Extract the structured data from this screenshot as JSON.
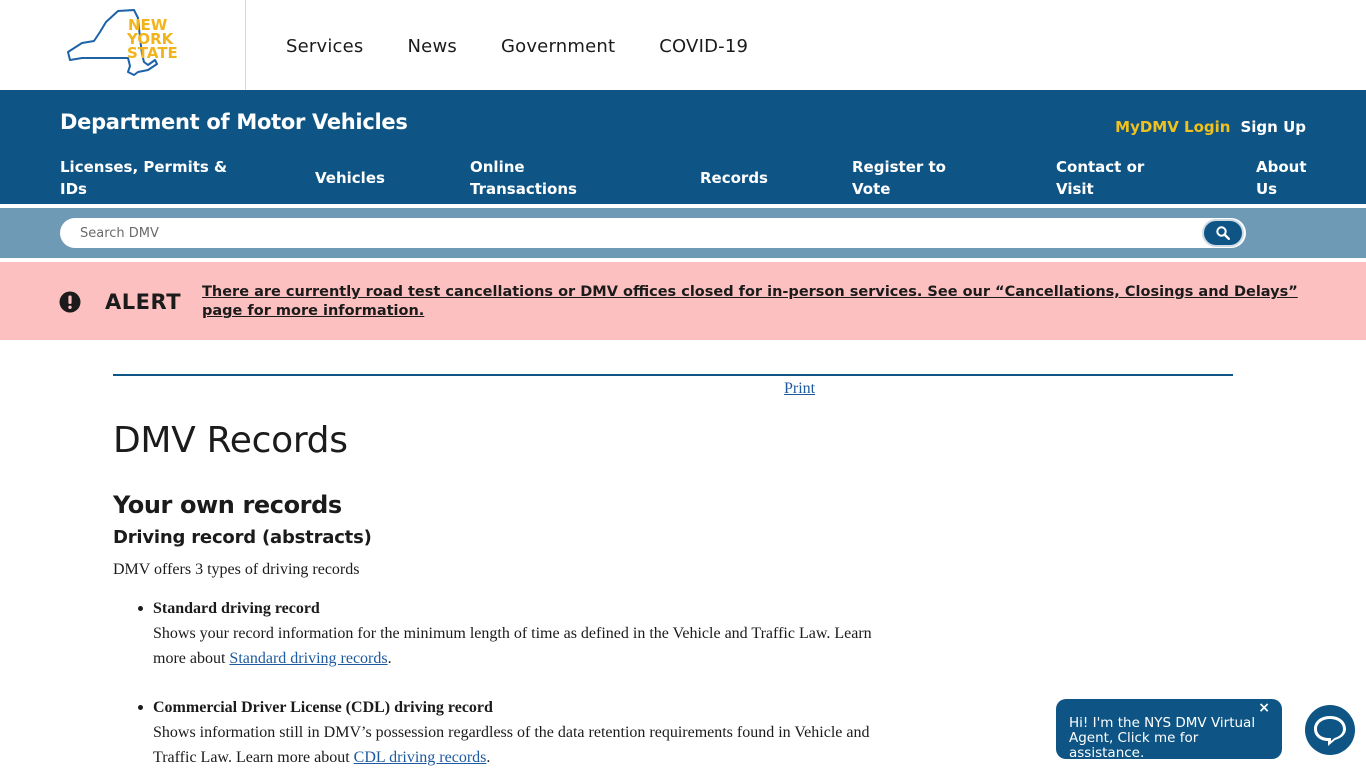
{
  "global_nav": {
    "items": [
      "Services",
      "News",
      "Government",
      "COVID-19"
    ]
  },
  "logo": {
    "lines": [
      "NEW",
      "YORK",
      "STATE"
    ],
    "colors": {
      "state_outline": "#1e63a8",
      "text": "#f1b41c"
    }
  },
  "agency": {
    "title": "Department of Motor Vehicles",
    "login_label": "MyDMV Login",
    "signup_label": "Sign Up",
    "nav": [
      {
        "line1": "Licenses, Permits &",
        "line2": "IDs"
      },
      {
        "line1": "Vehicles",
        "line2": ""
      },
      {
        "line1": "Online",
        "line2": "Transactions"
      },
      {
        "line1": "Records",
        "line2": ""
      },
      {
        "line1": "Register to",
        "line2": "Vote"
      },
      {
        "line1": "Contact or",
        "line2": "Visit"
      },
      {
        "line1": "About",
        "line2": "Us"
      }
    ]
  },
  "search": {
    "placeholder": "Search DMV",
    "button_icon": "search-icon"
  },
  "alert": {
    "label": "ALERT",
    "icon": "exclamation-circle-icon",
    "message": "There are currently road test cancellations or DMV offices closed for in-person services. See our “Cancellations, Closings and Delays” page for more information."
  },
  "content": {
    "print_label": "Print",
    "title": "DMV Records",
    "section_heading": "Your own records",
    "subsection_heading": "Driving record (abstracts)",
    "intro": "DMV offers 3 types of driving records",
    "records": [
      {
        "name": "Standard driving record",
        "text": "Shows your record information for the minimum length of time as defined in the Vehicle and Traffic Law. Learn more about ",
        "link": "Standard driving records",
        "after": "."
      },
      {
        "name": "Commercial Driver License (CDL) driving record",
        "text": "Shows information still in DMV’s possession regardless of the data retention requirements found in Vehicle and Traffic Law. Learn more about ",
        "link": "CDL driving records",
        "after": "."
      }
    ]
  },
  "chat": {
    "message": "Hi! I'm the NYS DMV Virtual Agent, Click me for assistance.",
    "close_label": "×",
    "launcher_icon": "chat-bubble-icon"
  },
  "colors": {
    "header_blue": "#0e5586",
    "search_band": "#6e9ab5",
    "alert_bg": "#fdc0c0",
    "link": "#1e5aa0",
    "login_yellow": "#f1c21b"
  }
}
